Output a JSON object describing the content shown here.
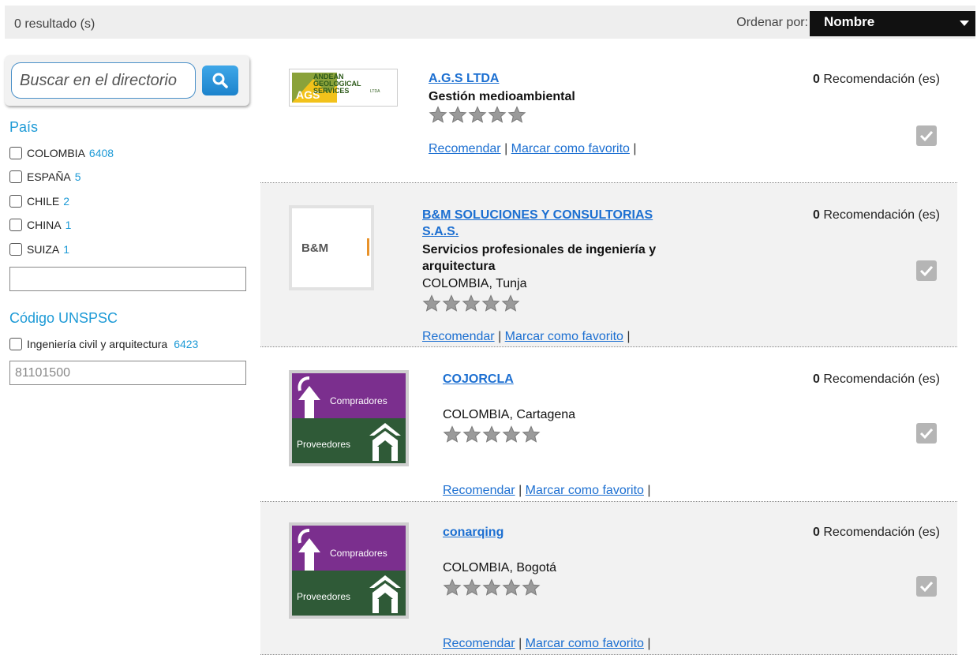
{
  "topbar": {
    "result_count": "0 resultado (s)",
    "sort_label": "Ordenar por:",
    "sort_value": "Nombre"
  },
  "sidebar": {
    "search_placeholder": "Buscar en el directorio",
    "country_title": "País",
    "countries": [
      {
        "name": "COLOMBIA",
        "count": "6408"
      },
      {
        "name": "ESPAÑA",
        "count": "5"
      },
      {
        "name": "CHILE",
        "count": "2"
      },
      {
        "name": "CHINA",
        "count": "1"
      },
      {
        "name": "SUIZA",
        "count": "1"
      }
    ],
    "country_filter_value": "",
    "unspsc_title": "Código UNSPSC",
    "unspsc_items": [
      {
        "name": "Ingeniería civil y arquitectura",
        "count": "6423"
      }
    ],
    "unspsc_placeholder": "81101500"
  },
  "results": [
    {
      "title": "A.G.S LTDA",
      "subtitle": "Gestión medioambiental",
      "location": "",
      "logo_text": [
        "ANDEAN",
        "GEOLOGICAL",
        "SERVICES"
      ],
      "logo_mark": "AGS",
      "logo_suffix": "LTDA",
      "rating": 0,
      "rec_count": "0",
      "rec_label": "Recomendación (es)",
      "recommend": "Recomendar",
      "favorite": "Marcar como favorito",
      "sep": "|"
    },
    {
      "title_line1": "B&M SOLUCIONES Y CONSULTORIAS",
      "title_line2": "S.A.S.",
      "subtitle_line1": "Servicios profesionales de ingeniería y",
      "subtitle_line2": "arquitectura",
      "location": "COLOMBIA, Tunja",
      "logo_text": "B&M",
      "rating": 0,
      "rec_count": "0",
      "rec_label": "Recomendación (es)",
      "recommend": "Recomendar",
      "favorite": "Marcar como favorito",
      "sep": "|"
    },
    {
      "title": "COJORCLA",
      "location": "COLOMBIA, Cartagena",
      "logo_top": "Compradores",
      "logo_bottom": "Proveedores",
      "rating": 0,
      "rec_count": "0",
      "rec_label": "Recomendación (es)",
      "recommend": "Recomendar",
      "favorite": "Marcar como favorito",
      "sep": "|"
    },
    {
      "title": "conarqing",
      "location": "COLOMBIA, Bogotá",
      "logo_top": "Compradores",
      "logo_bottom": "Proveedores",
      "rating": 0,
      "rec_count": "0",
      "rec_label": "Recomendación (es)",
      "recommend": "Recomendar",
      "favorite": "Marcar como favorito",
      "sep": "|"
    }
  ],
  "colors": {
    "link": "#1c6fd1",
    "facet": "#1d9ad6",
    "cp_purple": "#7b2f8e",
    "cp_green": "#2f5a37"
  }
}
